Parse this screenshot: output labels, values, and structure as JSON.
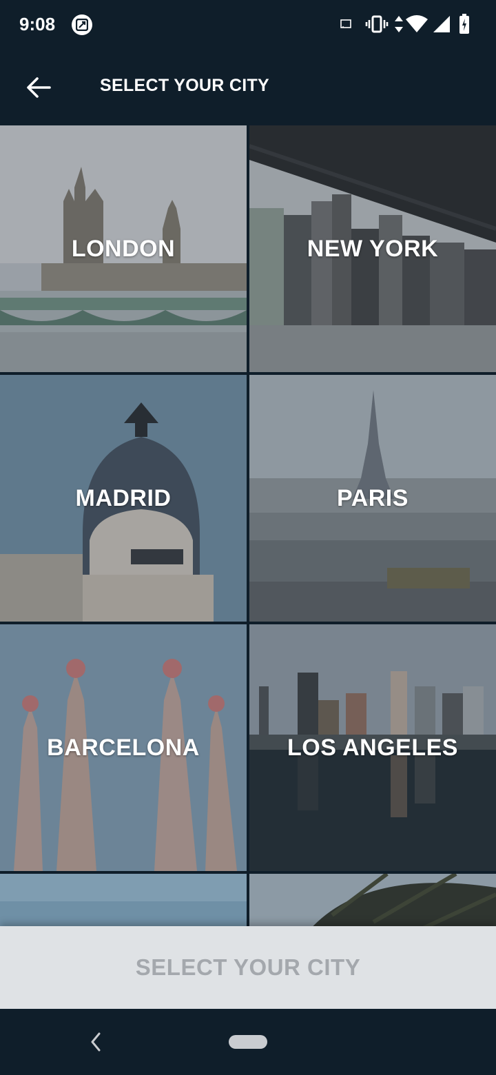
{
  "status_bar": {
    "time": "9:08",
    "icons": [
      "photo-badge-icon",
      "cast-icon",
      "vibrate-icon",
      "data-arrows-icon",
      "wifi-icon",
      "signal-icon",
      "battery-icon"
    ]
  },
  "header": {
    "title": "SELECT YOUR CITY",
    "back_icon": "arrow-left-icon"
  },
  "cities": [
    {
      "label": "LONDON"
    },
    {
      "label": "NEW YORK"
    },
    {
      "label": "MADRID"
    },
    {
      "label": "PARIS"
    },
    {
      "label": "BARCELONA"
    },
    {
      "label": "LOS ANGELES"
    },
    {
      "label": ""
    },
    {
      "label": ""
    }
  ],
  "footer": {
    "select_label": "SELECT YOUR CITY"
  },
  "colors": {
    "background": "#0f1e2a",
    "footer": "#dfe2e5",
    "footer_text_disabled": "#a4a8ad"
  }
}
